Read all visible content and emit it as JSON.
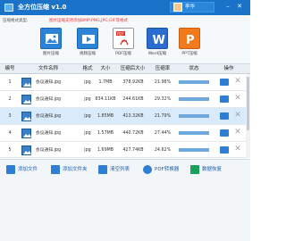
{
  "window": {
    "title": "全方位压缩 v1.0",
    "user_name": "李华",
    "minimize_icon": "minimize-icon",
    "close_icon": "close-icon"
  },
  "toolbar": {
    "hint_label": "压缩格式类型:",
    "hint_text": "图片压缩支持添加BMP,PNG,JPG,GIF等格式",
    "tools": [
      {
        "label": "图片压缩",
        "icon": "image-icon"
      },
      {
        "label": "视频压缩",
        "icon": "video-icon"
      },
      {
        "label": "PDF压缩",
        "icon": "pdf-icon"
      },
      {
        "label": "Word压缩",
        "icon": "word-icon"
      },
      {
        "label": "PPT压缩",
        "icon": "ppt-icon"
      }
    ]
  },
  "table": {
    "headers": [
      "编号",
      "文件名称",
      "格式",
      "大小",
      "压缩后大小",
      "压缩率",
      "状态",
      "操作"
    ],
    "rows": [
      {
        "index": "1",
        "name": "会议通知.jpg",
        "format": "jpg",
        "size": "1.7MB",
        "compressed_size": "378.92KB",
        "ratio": "21.98%",
        "progress": 1.0
      },
      {
        "index": "2",
        "name": "会议通知.jpg",
        "format": "jpg",
        "size": "834.11KB",
        "compressed_size": "244.61KB",
        "ratio": "29.32%",
        "progress": 1.0
      },
      {
        "index": "3",
        "name": "会议通知.jpg",
        "format": "jpg",
        "size": "1.85MB",
        "compressed_size": "413.32KB",
        "ratio": "21.79%",
        "progress": 1.0
      },
      {
        "index": "4",
        "name": "会议通知.jpg",
        "format": "jpg",
        "size": "1.57MB",
        "compressed_size": "440.72KB",
        "ratio": "27.44%",
        "progress": 1.0
      },
      {
        "index": "5",
        "name": "会议通知.jpg",
        "format": "jpg",
        "size": "1.69MB",
        "compressed_size": "427.74KB",
        "ratio": "24.62%",
        "progress": 1.0
      }
    ],
    "folder_icon": "folder-icon",
    "delete_icon": "delete-icon"
  },
  "bottom_bar": {
    "buttons": [
      {
        "label": "添加文件",
        "icon": "add-file-icon"
      },
      {
        "label": "添加文件夹",
        "icon": "add-folder-icon"
      },
      {
        "label": "清空列表",
        "icon": "clear-list-icon"
      },
      {
        "label": "PDF转换器",
        "icon": "pdf-converter-icon"
      },
      {
        "label": "数据恢复",
        "icon": "data-recovery-icon"
      }
    ]
  },
  "colors": {
    "titlebar": "#1a73c9",
    "selected_row": "#d9ebfb",
    "hint_text": "#ee3333",
    "progress_fill": "#6fa8dc",
    "link_text": "#1a5ea8"
  }
}
